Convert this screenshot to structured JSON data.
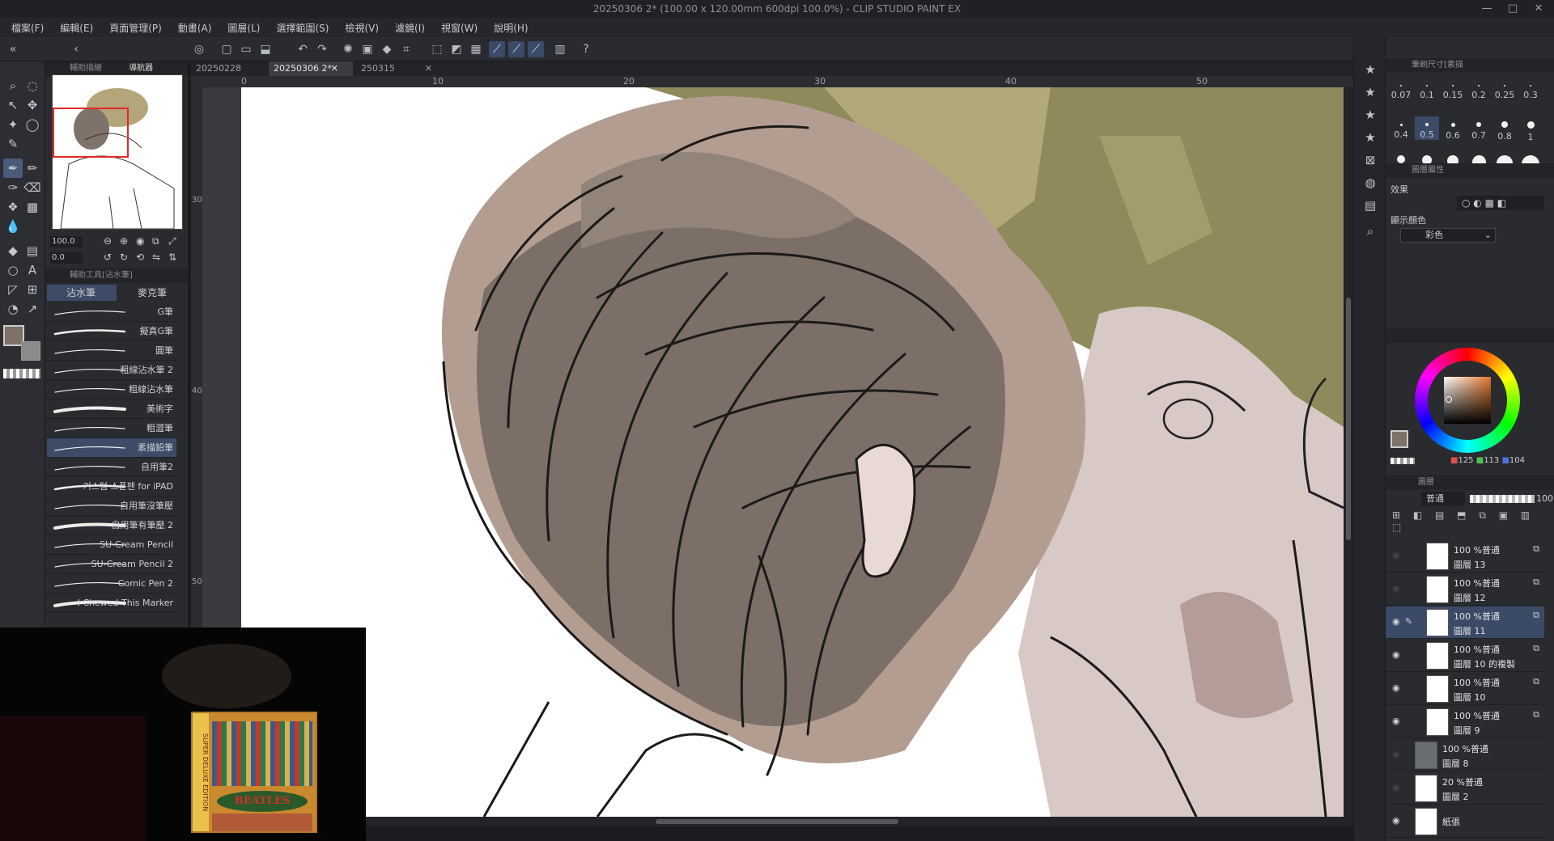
{
  "window": {
    "title": "20250306 2* (100.00 x 120.00mm 600dpi 100.0%) - CLIP STUDIO PAINT EX",
    "minimize": "—",
    "maximize": "□",
    "close": "✕"
  },
  "menu": [
    "檔案(F)",
    "編輯(E)",
    "頁面管理(P)",
    "動畫(A)",
    "圖層(L)",
    "選擇範圍(S)",
    "檢視(V)",
    "濾鏡(I)",
    "視窗(W)",
    "說明(H)"
  ],
  "left": {
    "tab_sub_tool": "輔助描繪",
    "tab_navigator": "導航器",
    "nav_zoom": "100.0",
    "nav_rotate": "0.0",
    "subtool_panel_title": "輔助工具[沾水筆]",
    "subtool_tabs": [
      "沾水筆",
      "麥克筆"
    ],
    "brushes": [
      "G筆",
      "擬真G筆",
      "圓筆",
      "粗線沾水筆 2",
      "粗線沾水筆",
      "美術字",
      "粗澀筆",
      "素描鉛筆",
      "自用筆2",
      "커스텀 스푼펜 for iPAD",
      "自用筆沒筆壓",
      "自用筆有筆壓 2",
      "SU-Cream Pencil",
      "SU-Cream Pencil 2",
      "Comic Pen 2",
      "I Chewed This Marker"
    ],
    "selected_brush_index": 7
  },
  "tabs": [
    {
      "label": "20250228"
    },
    {
      "label": "20250306 2*",
      "active": true
    },
    {
      "label": "250315"
    }
  ],
  "ruler_top": [
    "0",
    "10",
    "20",
    "30",
    "40",
    "50"
  ],
  "ruler_left": [
    "30",
    "40",
    "50"
  ],
  "brush_size": {
    "panel_title": "筆刷尺寸[素描",
    "sizes": [
      [
        "0.07",
        "0.1",
        "0.15",
        "0.2",
        "0.25",
        "0.3"
      ],
      [
        "0.4",
        "0.5",
        "0.6",
        "0.7",
        "0.8",
        "1"
      ]
    ],
    "selected": "0.5"
  },
  "layer_property": {
    "panel_title": "圖層屬性",
    "effect_label": "效果",
    "display_color_label": "顯示顏色",
    "display_color_value": "彩色"
  },
  "color": {
    "main": "#7d7168",
    "sub": "#8b8b8b",
    "r": "125",
    "g": "113",
    "b": "104"
  },
  "layers_panel": {
    "tab_label": "圖層",
    "blend_mode": "普通",
    "opacity": "100"
  },
  "layers": [
    {
      "mode": "100 %普通",
      "name": "圖層 13",
      "visible": false,
      "selected": false
    },
    {
      "mode": "100 %普通",
      "name": "圖層 12",
      "visible": false,
      "selected": false
    },
    {
      "mode": "100 %普通",
      "name": "圖層 11",
      "visible": true,
      "selected": true
    },
    {
      "mode": "100 %普通",
      "name": "圖層 10 的複製",
      "visible": true,
      "selected": false
    },
    {
      "mode": "100 %普通",
      "name": "圖層 10",
      "visible": true,
      "selected": false
    },
    {
      "mode": "100 %普通",
      "name": "圖層 9",
      "visible": true,
      "selected": false
    },
    {
      "mode": "100 %普通",
      "name": "圖層 8",
      "visible": false,
      "selected": false
    },
    {
      "mode": "20 %普通",
      "name": "圖層 2",
      "visible": false,
      "selected": false
    },
    {
      "mode": "",
      "name": "紙張",
      "visible": true,
      "selected": false
    }
  ],
  "album_text": "BEATLES",
  "album_side": "SUPER DELUXE EDITION"
}
